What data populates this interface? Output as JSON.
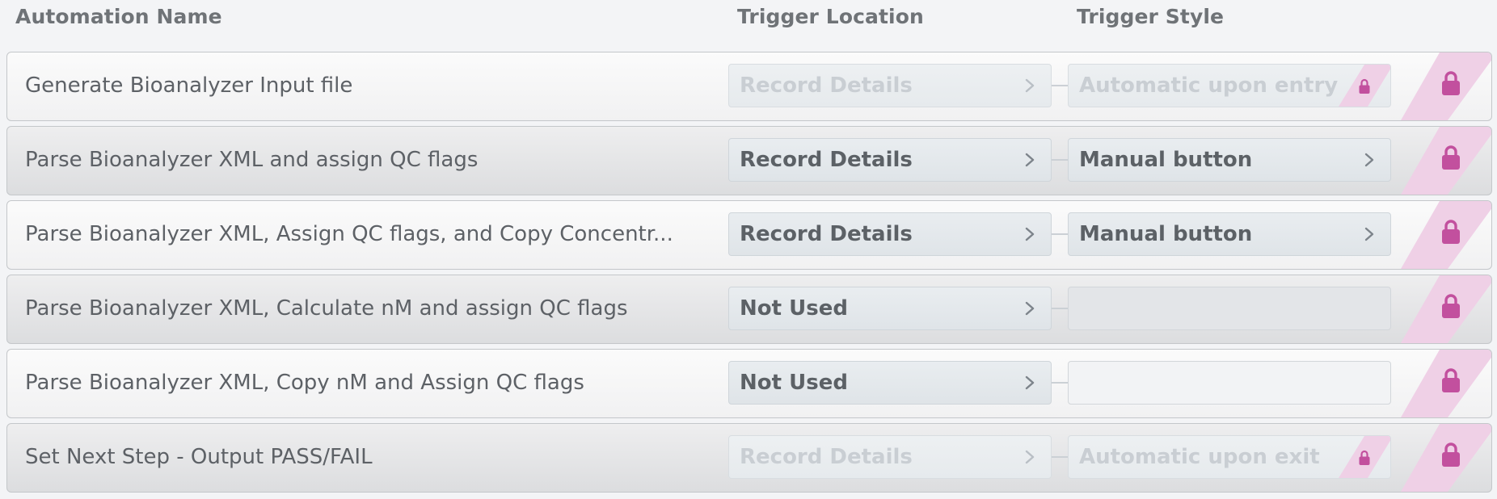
{
  "header": {
    "col_name": "Automation Name",
    "col_location": "Trigger Location",
    "col_style": "Trigger Style"
  },
  "colors": {
    "lock_accent": "#c2509e",
    "lock_stripe": "#efd0e6"
  },
  "rows": [
    {
      "name": "Generate Bioanalyzer Input file",
      "location": "Record Details",
      "location_state": "disabled",
      "style": "Automatic upon entry",
      "style_state": "locked",
      "locked": true
    },
    {
      "name": "Parse Bioanalyzer XML and assign QC flags",
      "location": "Record Details",
      "location_state": "enabled",
      "style": "Manual button",
      "style_state": "enabled",
      "locked": true
    },
    {
      "name": "Parse Bioanalyzer XML, Assign QC flags, and Copy Concentr...",
      "location": "Record Details",
      "location_state": "enabled",
      "style": "Manual button",
      "style_state": "enabled",
      "locked": true
    },
    {
      "name": "Parse Bioanalyzer XML, Calculate nM and assign QC flags",
      "location": "Not Used",
      "location_state": "enabled",
      "style": "",
      "style_state": "empty",
      "locked": true
    },
    {
      "name": "Parse Bioanalyzer XML, Copy nM and Assign QC flags",
      "location": "Not Used",
      "location_state": "enabled",
      "style": "",
      "style_state": "empty",
      "locked": true
    },
    {
      "name": "Set Next Step - Output PASS/FAIL",
      "location": "Record Details",
      "location_state": "disabled",
      "style": "Automatic upon exit",
      "style_state": "locked",
      "locked": true
    }
  ]
}
